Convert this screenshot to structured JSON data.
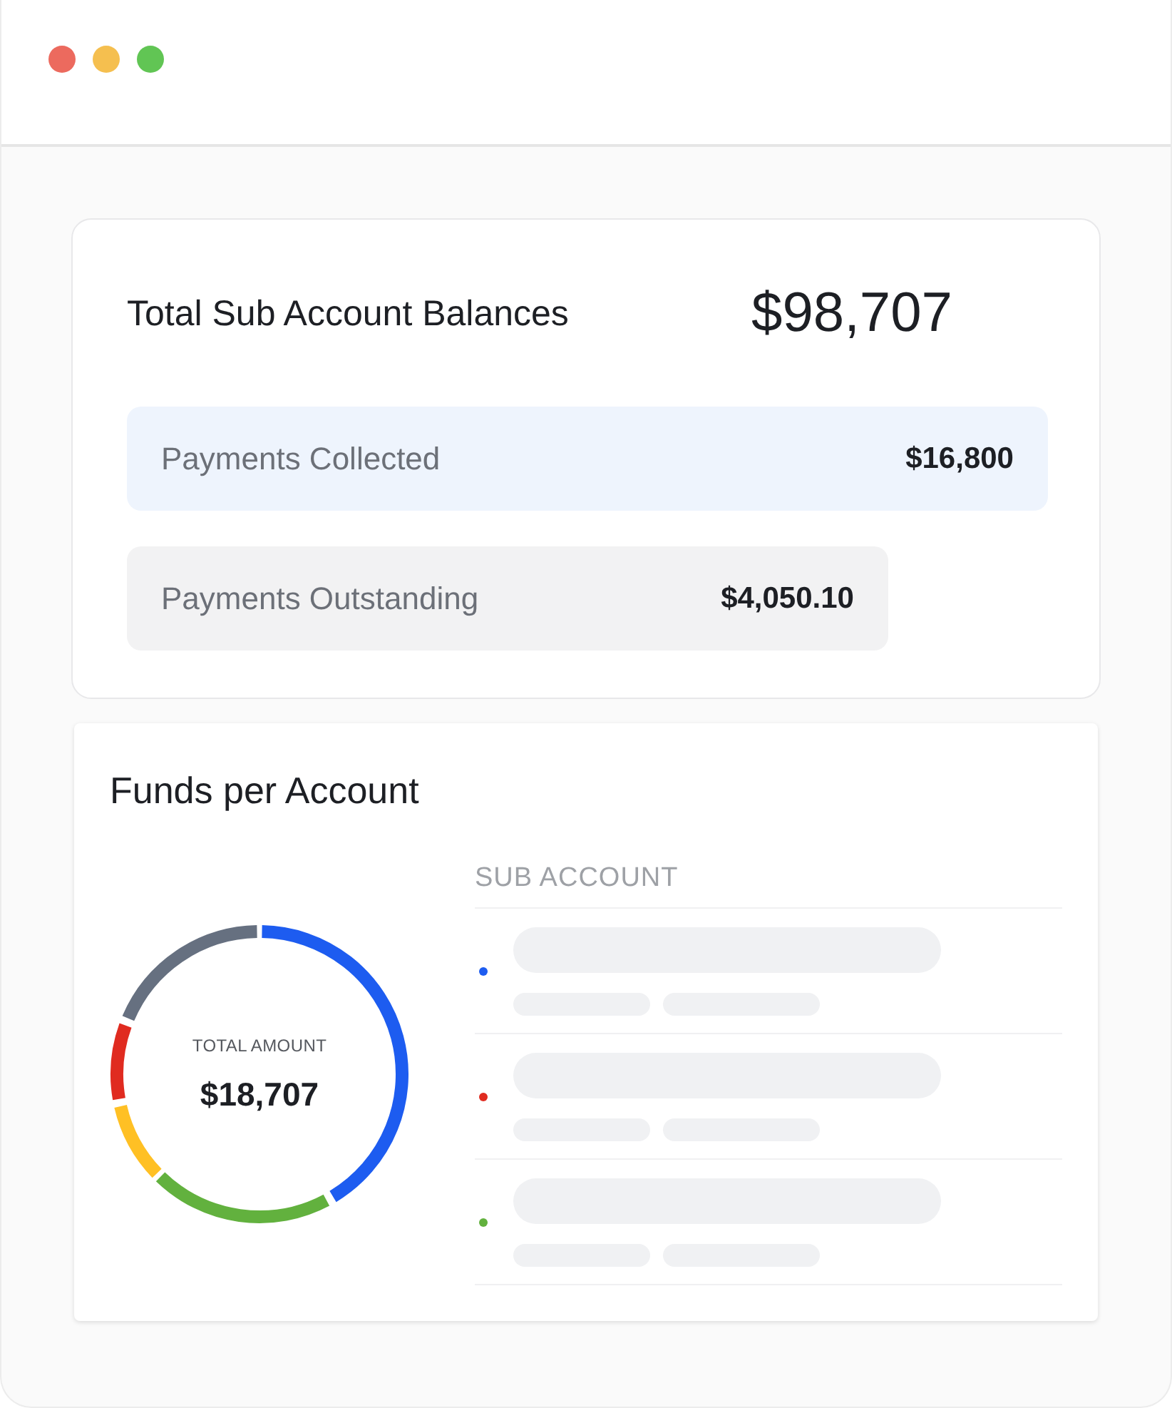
{
  "window": {
    "controls": [
      {
        "color": "#ec6a5e"
      },
      {
        "color": "#f5bf4f"
      },
      {
        "color": "#61c554"
      }
    ]
  },
  "balances": {
    "title": "Total Sub Account Balances",
    "total": "$98,707",
    "rows": [
      {
        "kind": "collected",
        "label": "Payments Collected",
        "amount": "$16,800"
      },
      {
        "kind": "outstanding",
        "label": "Payments Outstanding",
        "amount": "$4,050.10"
      }
    ]
  },
  "funds": {
    "title": "Funds per Account",
    "donut_label": "TOTAL AMOUNT",
    "donut_total": "$18,707",
    "column": "SUB ACCOUNT",
    "sub_accounts": [
      {
        "color": "#1d5cf0"
      },
      {
        "color": "#e02b20"
      },
      {
        "color": "#62b13e"
      }
    ]
  }
}
